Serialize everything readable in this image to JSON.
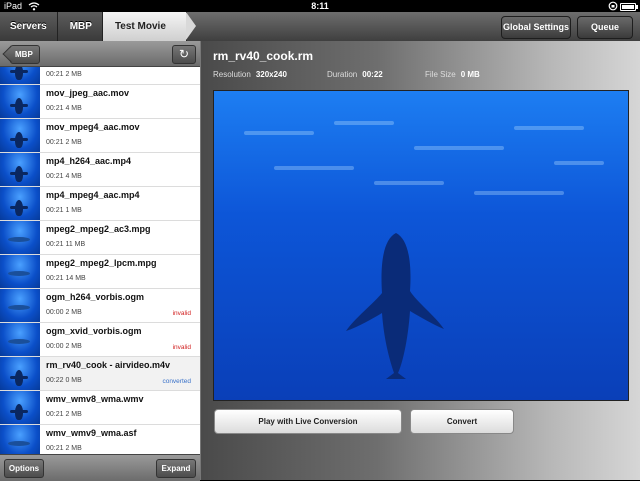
{
  "status": {
    "carrier": "iPad",
    "time": "8:11"
  },
  "nav": {
    "crumbs": [
      "Servers",
      "MBP",
      "Test Movie"
    ],
    "global_settings": "Global Settings",
    "queue": "Queue"
  },
  "left": {
    "back_label": "MBP",
    "refresh_icon": "↻",
    "items": [
      {
        "name": "",
        "meta": "00:21  2 MB",
        "badge": "",
        "thumb": "whale"
      },
      {
        "name": "mov_jpeg_aac.mov",
        "meta": "00:21  4 MB",
        "badge": "",
        "thumb": "whale"
      },
      {
        "name": "mov_mpeg4_aac.mov",
        "meta": "00:21  2 MB",
        "badge": "",
        "thumb": "whale"
      },
      {
        "name": "mp4_h264_aac.mp4",
        "meta": "00:21  4 MB",
        "badge": "",
        "thumb": "whale"
      },
      {
        "name": "mp4_mpeg4_aac.mp4",
        "meta": "00:21  1 MB",
        "badge": "",
        "thumb": "whale"
      },
      {
        "name": "mpeg2_mpeg2_ac3.mpg",
        "meta": "00:21  11 MB",
        "badge": "",
        "thumb": "fish"
      },
      {
        "name": "mpeg2_mpeg2_lpcm.mpg",
        "meta": "00:21  14 MB",
        "badge": "",
        "thumb": "fish"
      },
      {
        "name": "ogm_h264_vorbis.ogm",
        "meta": "00:00  2 MB",
        "badge": "invalid",
        "thumb": "fish"
      },
      {
        "name": "ogm_xvid_vorbis.ogm",
        "meta": "00:00  2 MB",
        "badge": "invalid",
        "thumb": "fish"
      },
      {
        "name": "rm_rv40_cook - airvideo.m4v",
        "meta": "00:22  0 MB",
        "badge": "converted",
        "thumb": "whale"
      },
      {
        "name": "wmv_wmv8_wma.wmv",
        "meta": "00:21  2 MB",
        "badge": "",
        "thumb": "whale"
      },
      {
        "name": "wmv_wmv9_wma.asf",
        "meta": "00:21  2 MB",
        "badge": "",
        "thumb": "fish"
      }
    ],
    "options": "Options",
    "expand": "Expand"
  },
  "detail": {
    "title": "rm_rv40_cook.rm",
    "resolution_label": "Resolution",
    "resolution": "320x240",
    "duration_label": "Duration",
    "duration": "00:22",
    "filesize_label": "File Size",
    "filesize": "0 MB",
    "play_button": "Play with Live Conversion",
    "convert_button": "Convert"
  },
  "colors": {
    "invalid": "#d12020",
    "converted": "#3a72c9",
    "video_blue": "#0d56d8"
  }
}
